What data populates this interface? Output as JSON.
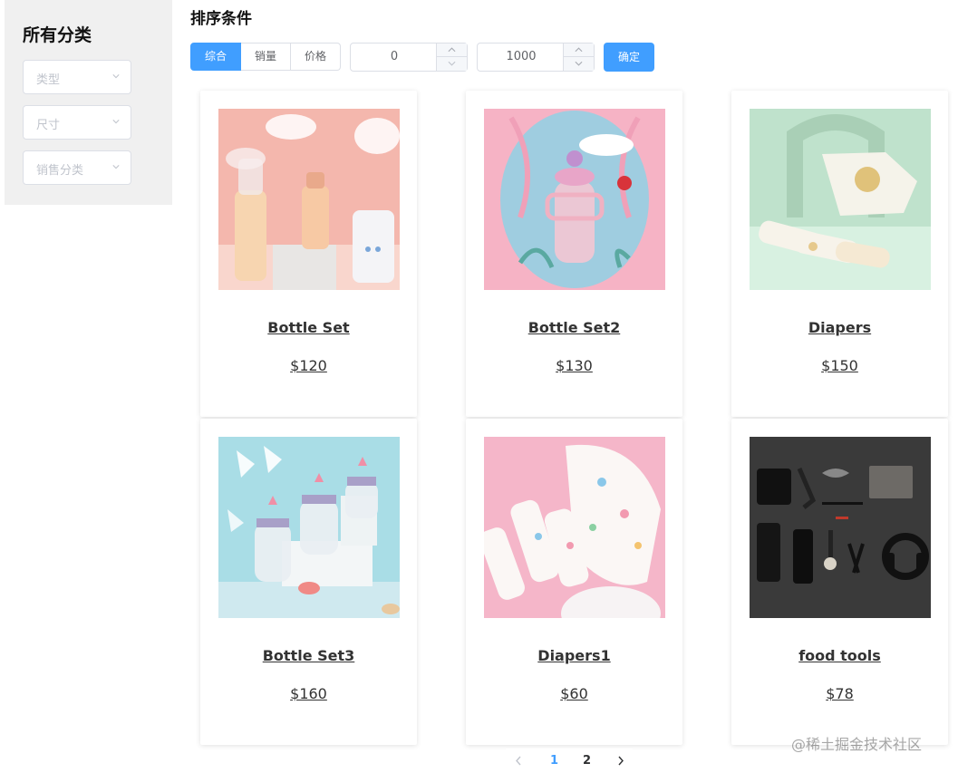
{
  "sidebar": {
    "title": "所有分类",
    "selects": [
      {
        "placeholder": "类型"
      },
      {
        "placeholder": "尺寸"
      },
      {
        "placeholder": "销售分类"
      }
    ]
  },
  "toolbar": {
    "title": "排序条件",
    "sort_options": [
      "综合",
      "销量",
      "价格"
    ],
    "active_sort": "综合",
    "min_price": "0",
    "max_price": "1000",
    "confirm_label": "确定"
  },
  "products": [
    {
      "name": "Bottle Set",
      "price": "$120",
      "image": "bottle-pump-photo"
    },
    {
      "name": "Bottle Set2",
      "price": "$130",
      "image": "pink-sippy-cup-photo"
    },
    {
      "name": "Diapers",
      "price": "$150",
      "image": "diapers-photo"
    },
    {
      "name": "Bottle Set3",
      "price": "$160",
      "image": "crown-bottles-photo"
    },
    {
      "name": "Diapers1",
      "price": "$60",
      "image": "muslin-cloth-photo"
    },
    {
      "name": "food tools",
      "price": "$78",
      "image": "accessories-flatlay-photo"
    }
  ],
  "pagination": {
    "pages": [
      "1",
      "2"
    ],
    "current_page": "1"
  },
  "watermark": "@稀土掘金技术社区",
  "colors": {
    "primary": "#409eff",
    "sidebar_bg": "#f0f0f0",
    "border": "#dcdfe6"
  }
}
